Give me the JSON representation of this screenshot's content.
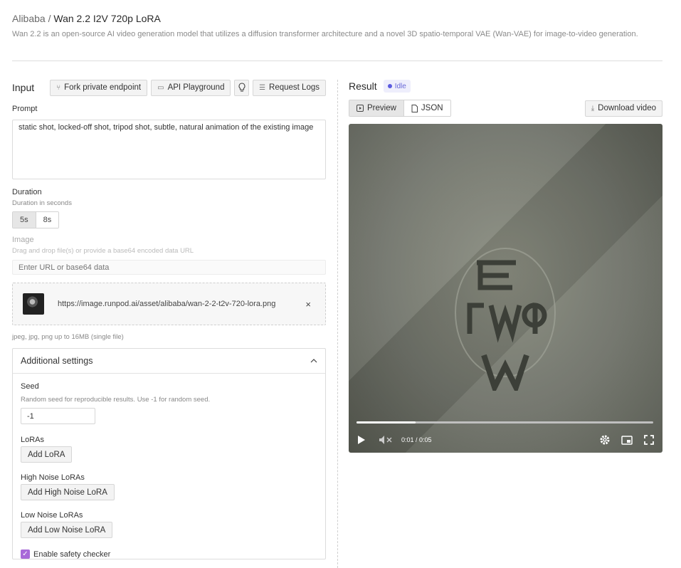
{
  "header": {
    "breadcrumb_root": "Alibaba",
    "separator": " / ",
    "model_title": "Wan 2.2 I2V 720p LoRA",
    "description": "Wan 2.2 is an open-source AI video generation model that utilizes a diffusion transformer architecture and a novel 3D spatio-temporal VAE (Wan-VAE) for image-to-video generation."
  },
  "input": {
    "title": "Input",
    "buttons": {
      "fork": "Fork private endpoint",
      "playground": "API Playground",
      "logs": "Request Logs"
    },
    "prompt": {
      "label": "Prompt",
      "value": "static shot, locked-off shot, tripod shot, subtle, natural animation of the existing image"
    },
    "duration": {
      "label": "Duration",
      "help": "Duration in seconds",
      "options": [
        "5s",
        "8s"
      ],
      "selected": "5s"
    },
    "image": {
      "label": "Image",
      "help": "Drag and drop file(s) or provide a base64 encoded data URL",
      "placeholder": "Enter URL or base64 data",
      "file_url": "https://image.runpod.ai/asset/alibaba/wan-2-2-t2v-720-lora.png",
      "remove_glyph": "×",
      "file_hint": "jpeg, jpg, png up to 16MB (single file)"
    },
    "additional": {
      "title": "Additional settings",
      "seed": {
        "label": "Seed",
        "help": "Random seed for reproducible results. Use -1 for random seed.",
        "value": "-1"
      },
      "loras": {
        "label": "LoRAs",
        "button": "Add LoRA"
      },
      "high_noise": {
        "label": "High Noise LoRAs",
        "button": "Add High Noise LoRA"
      },
      "low_noise": {
        "label": "Low Noise LoRAs",
        "button": "Add Low Noise LoRA"
      },
      "safety": {
        "label": "Enable safety checker",
        "checked": true
      }
    }
  },
  "result": {
    "title": "Result",
    "status": "Idle",
    "tabs": [
      "Preview",
      "JSON"
    ],
    "active_tab": "Preview",
    "download": "Download video",
    "player": {
      "time": "0:01 / 0:05",
      "progress": 0.2
    }
  },
  "colors": {
    "accent_purple": "#a86ad8",
    "status_blue": "#5b5be0"
  }
}
